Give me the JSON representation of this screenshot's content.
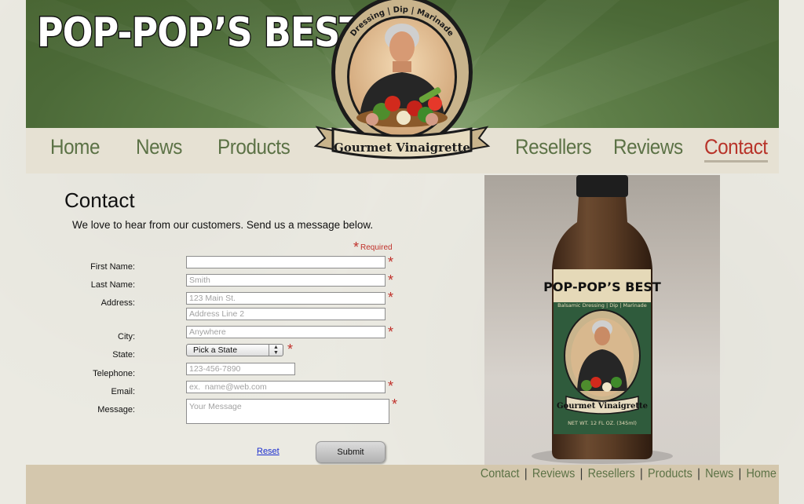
{
  "header": {
    "logo_text": "POP-POP’S BEST",
    "badge_top_text": "Dressing | Dip | Marinade",
    "badge_ribbon_text": "Gourmet Vinaigrette"
  },
  "nav": {
    "items": [
      {
        "label": "Home"
      },
      {
        "label": "News"
      },
      {
        "label": "Products"
      },
      {
        "label": "Resellers"
      },
      {
        "label": "Reviews"
      },
      {
        "label": "Contact"
      }
    ],
    "active": "Contact"
  },
  "content": {
    "title": "Contact",
    "intro": "We love to hear from our customers. Send us a message below.",
    "required_note": "Required"
  },
  "form": {
    "first_name": {
      "label": "First Name:",
      "placeholder": "",
      "value": ""
    },
    "last_name": {
      "label": "Last Name:",
      "placeholder": "Smith"
    },
    "address": {
      "label": "Address:",
      "placeholder": "123 Main St."
    },
    "address2": {
      "placeholder": "Address Line 2"
    },
    "city": {
      "label": "City:",
      "placeholder": "Anywhere"
    },
    "state": {
      "label": "State:",
      "selected": "Pick a State"
    },
    "telephone": {
      "label": "Telephone:",
      "placeholder": "123-456-7890"
    },
    "email": {
      "label": "Email:",
      "placeholder": "ex.  name@web.com"
    },
    "message": {
      "label": "Message:",
      "placeholder": "Your Message"
    },
    "reset_label": "Reset",
    "submit_label": "Submit",
    "required_marker": "*"
  },
  "product": {
    "label_title": "POP-POP’S BEST",
    "label_sub": "Balsamic Dressing | Dip | Marinade",
    "label_ribbon": "Gourmet Vinaigrette",
    "label_weight": "NET WT. 12 FL OZ. (345ml)"
  },
  "footer": {
    "links": [
      "Contact",
      "Reviews",
      "Resellers",
      "Products",
      "News",
      "Home"
    ],
    "separator": "|"
  },
  "colors": {
    "banner_green": "#4c6a38",
    "nav_green": "#5c7246",
    "active_red": "#b8342a",
    "required_red": "#c0302a",
    "footer_tan": "#d4c7ad"
  }
}
